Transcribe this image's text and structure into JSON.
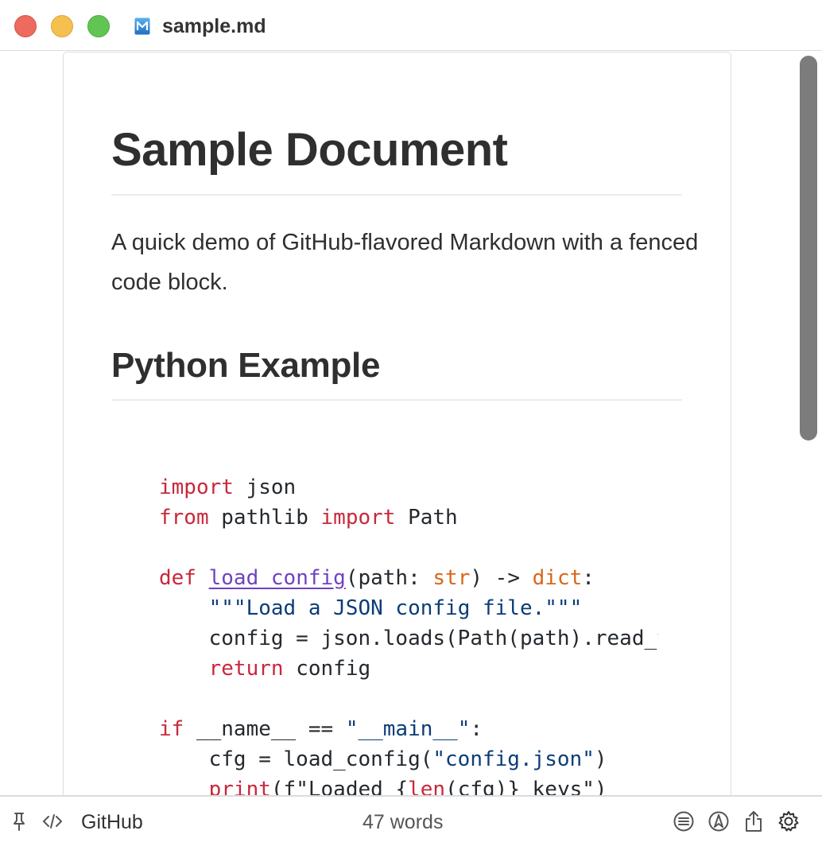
{
  "window": {
    "title": "sample.md",
    "file_icon": "markdown-file-icon"
  },
  "document": {
    "h1": "Sample Document",
    "paragraph": "A quick demo of GitHub-flavored Markdown with a fenced code block.",
    "h2": "Python Example",
    "code_lines": [
      [
        {
          "t": "import",
          "c": "keyword"
        },
        {
          "t": " json"
        }
      ],
      [
        {
          "t": "from",
          "c": "keyword"
        },
        {
          "t": " pathlib "
        },
        {
          "t": "import",
          "c": "keyword"
        },
        {
          "t": " Path"
        }
      ],
      [],
      [
        {
          "t": "def",
          "c": "keyword"
        },
        {
          "t": " "
        },
        {
          "t": "load_config",
          "c": "function"
        },
        {
          "t": "(path: "
        },
        {
          "t": "str",
          "c": "builtin"
        },
        {
          "t": ") -> "
        },
        {
          "t": "dict",
          "c": "builtin"
        },
        {
          "t": ":"
        }
      ],
      [
        {
          "t": "    "
        },
        {
          "t": "\"\"\"Load a JSON config file.\"\"\"",
          "c": "string"
        }
      ],
      [
        {
          "t": "    config = json.loads(Path(path).read_text())"
        }
      ],
      [
        {
          "t": "    "
        },
        {
          "t": "return",
          "c": "keyword"
        },
        {
          "t": " config"
        }
      ],
      [],
      [
        {
          "t": "if",
          "c": "keyword"
        },
        {
          "t": " __name__ == "
        },
        {
          "t": "\"__main__\"",
          "c": "string"
        },
        {
          "t": ":"
        }
      ],
      [
        {
          "t": "    cfg = load_config("
        },
        {
          "t": "\"config.json\"",
          "c": "string"
        },
        {
          "t": ")"
        }
      ],
      [
        {
          "t": "    "
        },
        {
          "t": "print",
          "c": "keyword"
        },
        {
          "t": "(f\"Loaded {"
        },
        {
          "t": "len",
          "c": "keyword"
        },
        {
          "t": "(cfg)} keys\")"
        }
      ]
    ]
  },
  "statusbar": {
    "pin_icon": "pin-icon",
    "source_icon": "code-icon",
    "theme": "GitHub",
    "word_count": "47 words",
    "icons": [
      "outline-icon",
      "navigate-icon",
      "share-icon",
      "gear-icon"
    ]
  },
  "colors": {
    "keyword": "#c8283c",
    "function": "#6f42c1",
    "builtin": "#d8671b",
    "string": "#0b3d78",
    "close": "#ed6a5e",
    "minimize": "#f5c04f",
    "maximize": "#61c554"
  }
}
